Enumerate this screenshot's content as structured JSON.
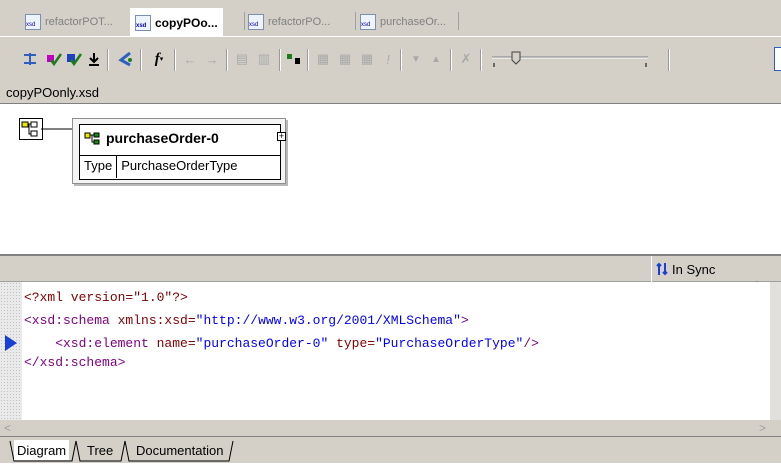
{
  "doc_tabs": [
    {
      "label": "refactorPOT..."
    },
    {
      "label": "copyPOo..."
    },
    {
      "label": "refactorPO..."
    },
    {
      "label": "purchaseOr..."
    }
  ],
  "path_bar": {
    "file": "copyPOonly.xsd"
  },
  "diagram": {
    "element_name": "purchaseOrder-0",
    "type_label": "Type",
    "type_value": "PurchaseOrderType"
  },
  "sync": {
    "label": "In Sync",
    "color": "#1a3fd6"
  },
  "source": {
    "line1": "<?xml version=\"1.0\"?>",
    "line2_tag": "<xsd:schema",
    "line2_attr": " xmlns:xsd=",
    "line2_val": "\"http://www.w3.org/2001/XMLSchema\"",
    "line2_end": ">",
    "line3_tag": "    <xsd:element",
    "line3_attr1": " name=",
    "line3_val1": "\"purchaseOrder-0\"",
    "line3_attr2": " type=",
    "line3_val2": "\"PurchaseOrderType\"",
    "line3_end": "/>",
    "line4": "</xsd:schema>"
  },
  "bottom_tabs": [
    {
      "label": "Diagram"
    },
    {
      "label": "Tree"
    },
    {
      "label": "Documentation"
    }
  ],
  "toolbar_icons": [
    "expand-icon",
    "validate-icon",
    "validate-all-icon",
    "download-icon",
    "spell-icon",
    "function-icon",
    "back-icon",
    "forward-icon",
    "copy-icon",
    "paste-icon",
    "wizard-icon",
    "insert-icon",
    "insert-after-icon",
    "append-icon",
    "bang-icon",
    "down-icon",
    "up-icon",
    "delete-icon",
    "zoom-slider"
  ]
}
